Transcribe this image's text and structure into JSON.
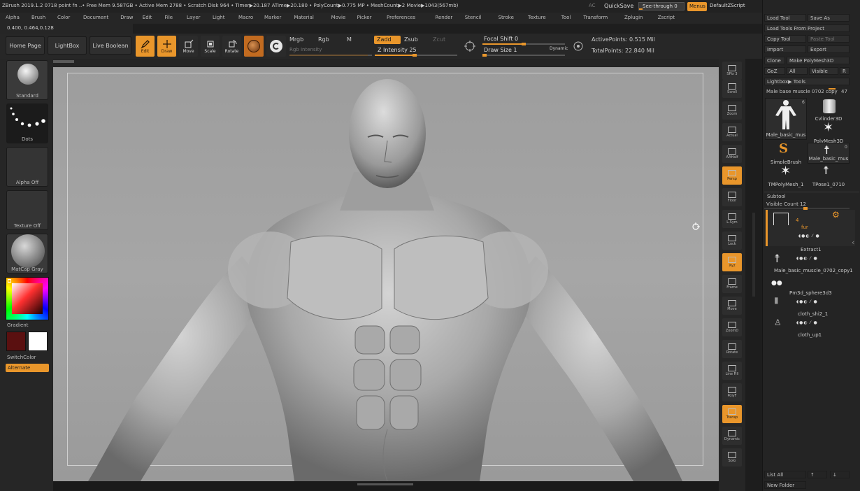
{
  "titlebar": {
    "text": "ZBrush 2019.1.2   0718 point fn  ..• Free Mem 9.587GB • Active Mem 2788 • Scratch Disk 964 • Timer▶20.187 ATime▶20.180 • PolyCount▶0.775 MP • MeshCount▶2  Movie▶1043(567mb)",
    "ac": "AC",
    "quicksave": "QuickSave",
    "see_through": "See-through  0",
    "menus": "Menus",
    "default_zscript": "DefaultZScript"
  },
  "menubar": [
    "Alpha",
    "Brush",
    "Color",
    "Document",
    "Draw",
    "Edit",
    "File",
    "Layer",
    "Light",
    "Macro",
    "Marker",
    "Material",
    "Movie",
    "Picker",
    "Preferences",
    "Render",
    "Stencil",
    "Stroke",
    "Texture",
    "Tool",
    "Transform",
    "Zplugin",
    "Zscript"
  ],
  "coords": "0.400, 0.464,0.128",
  "toolbar": {
    "home_page": "Home Page",
    "lightbox": "LightBox",
    "live_boolean": "Live Boolean",
    "edit": "Edit",
    "draw": "Draw",
    "move": "Move",
    "scale": "Scale",
    "rotate": "Rotate",
    "mrgb": "Mrgb",
    "rgb": "Rgb",
    "m": "M",
    "rgb_intensity": "Rgb Intensity",
    "zadd": "Zadd",
    "zsub": "Zsub",
    "zcut": "Zcut",
    "z_intensity": "Z Intensity 25",
    "focal_shift": "Focal Shift 0",
    "draw_size": "Draw Size 1",
    "dynamic": "Dynamic",
    "active_points": "ActivePoints: 0.515 Mil",
    "total_points": "TotalPoints: 22.840 Mil"
  },
  "leftshelf": {
    "brush": "Standard",
    "stroke": "Dots",
    "alpha": "Alpha Off",
    "texture": "Texture Off",
    "material": "MatCap Gray",
    "gradient": "Gradient",
    "switch_color": "SwitchColor",
    "alternate": "Alternate",
    "main_color": "#5a1010",
    "secondary_color": "#ffffff"
  },
  "rightshelf": [
    "SPix 3",
    "Scroll",
    "Zoom",
    "Actual",
    "AAHalf",
    "Persp",
    "Floor",
    "L.Sym",
    "Lock",
    "Xyz",
    "Frame",
    "Move",
    "ZoomD",
    "Rotate",
    "Line Fill",
    "PolyF",
    "Transp",
    "Dynamic",
    "Solo"
  ],
  "toolpanel": {
    "load_tool": "Load Tool",
    "save_as": "Save As",
    "load_tools_from_project": "Load Tools From Project",
    "copy_tool": "Copy Tool",
    "paste_tool": "Paste Tool",
    "import": "Import",
    "export": "Export",
    "clone": "Clone",
    "make_polymesh": "Make PolyMesh3D",
    "goz": "GoZ",
    "all": "All",
    "visible": "Visible",
    "r": "R",
    "lightbox_tools": "Lightbox▶ Tools",
    "current_tool": "Male base muscle 0702  copy",
    "copy_count": "47",
    "tools": [
      {
        "name": "Male_basic_mus",
        "count": "6"
      },
      {
        "name": "Cylinder3D",
        "count": ""
      },
      {
        "name": "SimpleBrush",
        "count": ""
      },
      {
        "name": "PolyMesh3D",
        "count": ""
      },
      {
        "name": "Male_basic_mus",
        "count": "0"
      },
      {
        "name": "TMPolyMesh_1",
        "count": ""
      },
      {
        "name": "TPose1_0710",
        "count": ""
      }
    ],
    "subtool": "Subtool",
    "visible_count": "Visible Count 12",
    "subtools": [
      {
        "name": "fur",
        "num": "4"
      },
      {
        "name": "Extract1",
        "num": ""
      },
      {
        "name": "Male_basic_muscle_0702_copy1",
        "num": ""
      },
      {
        "name": "Pm3d_sphere3d3",
        "num": ""
      },
      {
        "name": "cloth_shi2_1",
        "num": ""
      },
      {
        "name": "cloth_up1",
        "num": ""
      }
    ],
    "list_all": "List All",
    "new_folder": "New Folder"
  }
}
